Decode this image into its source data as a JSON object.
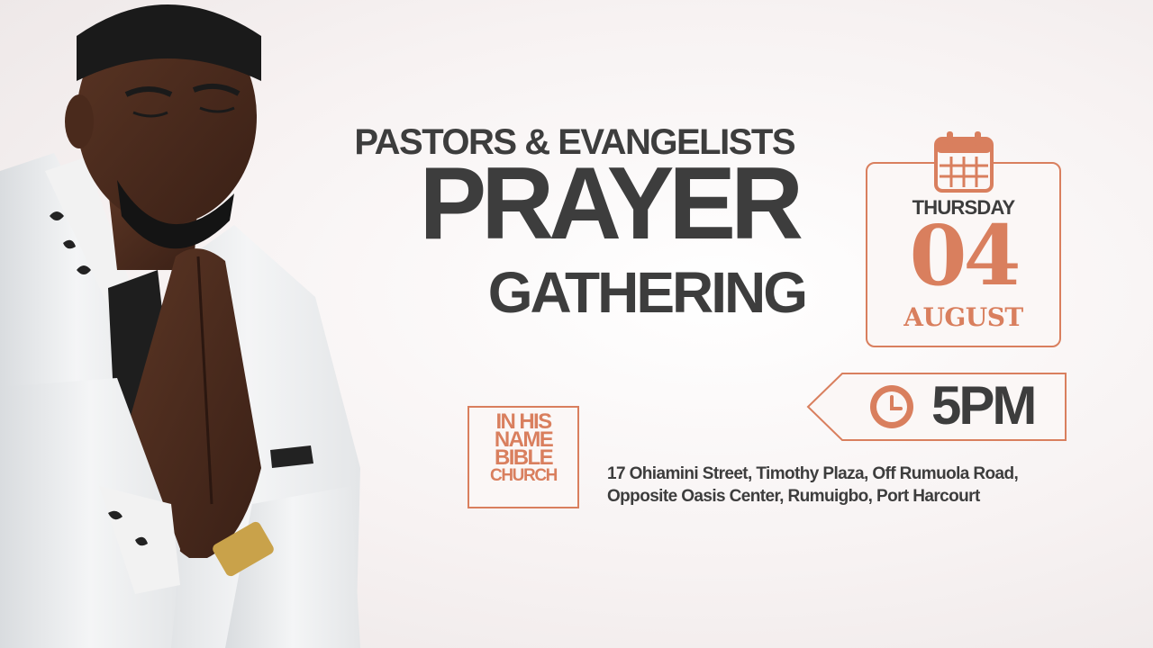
{
  "headline": {
    "line1": "PASTORS & EVANGELISTS",
    "line2": "PRAYER",
    "line3": "GATHERING"
  },
  "event_date": {
    "weekday": "THURSDAY",
    "day": "04",
    "month": "AUGUST"
  },
  "event_time": "5PM",
  "church_logo": {
    "lines": [
      "IN HIS",
      "NAME",
      "BIBLE",
      "CHURCH"
    ]
  },
  "venue_address": {
    "line1": "17 Ohiamini Street, Timothy Plaza, Off Rumuola Road,",
    "line2": "Opposite Oasis Center, Rumuigbo, Port Harcourt"
  },
  "colors": {
    "accent": "#d97f5e",
    "text_dark": "#3d3d3d",
    "background": "#f5f0f0"
  },
  "icons": [
    "calendar-icon",
    "clock-icon"
  ],
  "image": "man-praying-photo"
}
